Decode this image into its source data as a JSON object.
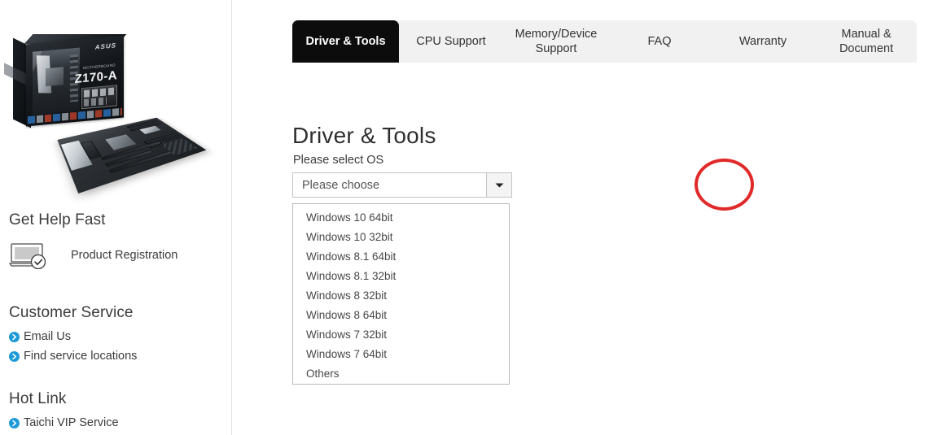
{
  "sidebar": {
    "product_image": {
      "icon": "asus-motherboard-product-photo",
      "brand": "ASUS",
      "model": "Z170-A",
      "model_sub": "MOTHERBOARD"
    },
    "sections": [
      {
        "heading": "Get Help Fast",
        "items": [
          {
            "label": "Product Registration",
            "icon": "laptop-check-icon"
          }
        ]
      },
      {
        "heading": "Customer Service",
        "items": [
          {
            "label": "Email Us",
            "icon": "chevron-circle-right-icon"
          },
          {
            "label": "Find service locations",
            "icon": "chevron-circle-right-icon"
          }
        ]
      },
      {
        "heading": "Hot Link",
        "items": [
          {
            "label": "Taichi VIP Service",
            "icon": "chevron-circle-right-icon"
          }
        ]
      }
    ]
  },
  "main": {
    "tabs": [
      {
        "label": "Driver & Tools",
        "active": true
      },
      {
        "label": "CPU Support",
        "active": false
      },
      {
        "label": "Memory/Device\nSupport",
        "active": false
      },
      {
        "label": "FAQ",
        "active": false
      },
      {
        "label": "Warranty",
        "active": false
      },
      {
        "label": "Manual &\nDocument",
        "active": false
      }
    ],
    "page_title": "Driver & Tools",
    "os_select": {
      "label": "Please select OS",
      "placeholder": "Please choose",
      "value": "Please choose",
      "arrow_icon": "caret-down-icon",
      "expanded": true,
      "options": [
        "Windows 10 64bit",
        "Windows 10 32bit",
        "Windows 8.1 64bit",
        "Windows 8.1 32bit",
        "Windows 8 32bit",
        "Windows 8 64bit",
        "Windows 7 32bit",
        "Windows 7 64bit",
        "Others"
      ]
    },
    "annotation": {
      "shape": "ellipse",
      "color": "#e02a2a",
      "target": "os-select-dropdown-arrow"
    }
  },
  "colors": {
    "active_tab_bg": "#0c0c0c",
    "tabbar_bg": "#f1f1f1",
    "link_bullet": "#1e9bd7",
    "annotation_red": "#e02a2a",
    "text_primary": "#3b3b3b",
    "border": "#c4c4c4"
  }
}
